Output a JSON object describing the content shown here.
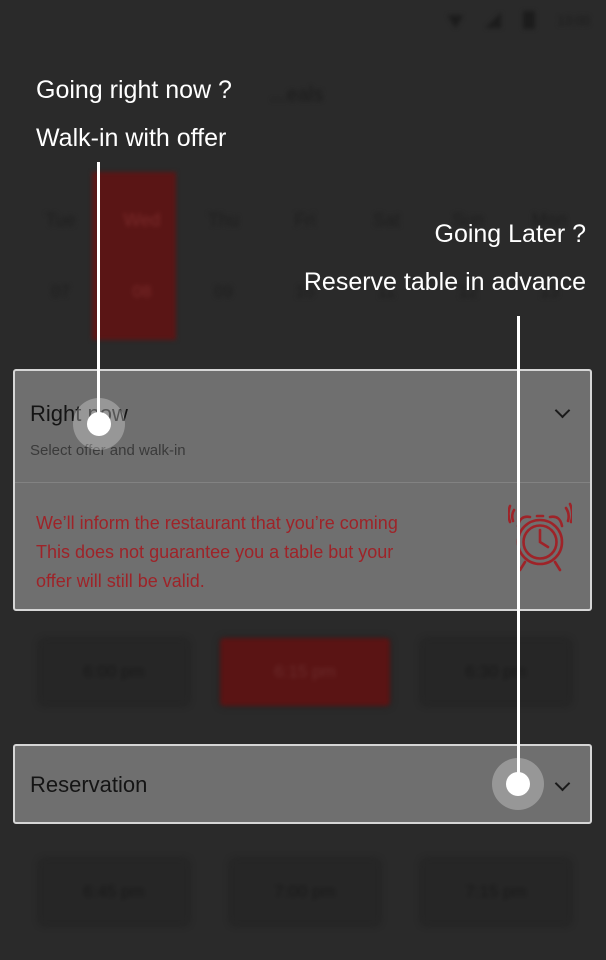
{
  "status_bar": {
    "time": "13:00"
  },
  "background": {
    "title": "...eals",
    "days": [
      "Tue",
      "Wed",
      "Thu",
      "Fri",
      "Sat",
      "Sun",
      "Mon"
    ],
    "dates": [
      "07",
      "08",
      "09",
      "10",
      "11",
      "12",
      "13"
    ],
    "selected_day_index": 1,
    "times_row1": [
      "6:00 pm",
      "6:15 pm",
      "6:30 pm"
    ],
    "times_row2": [
      "6:45 pm",
      "7:00 pm",
      "7:15 pm"
    ]
  },
  "right_now": {
    "title": "Right now",
    "subtitle": "Select offer and walk-in",
    "info_lines": [
      "We’ll inform the restaurant that you’re coming",
      "This does not guarantee you a table but your",
      "offer will still be valid."
    ]
  },
  "reservation": {
    "title": "Reservation"
  },
  "callouts": {
    "now": {
      "line1": "Going right now ?",
      "line2": "Walk-in with offer"
    },
    "later": {
      "line1": "Going Later ?",
      "line2": "Reserve table in advance"
    }
  },
  "icons": {
    "dropdown": "chevron-down-icon",
    "alarm": "alarm-clock-icon",
    "wifi": "wifi-icon",
    "signal": "signal-icon",
    "battery": "battery-icon"
  },
  "colors": {
    "overlay": "#2a2a2a",
    "panel": "#6f6f6f",
    "accent_red": "#9e2328",
    "selected_bg": "#5a1414",
    "callout": "#ffffff"
  }
}
